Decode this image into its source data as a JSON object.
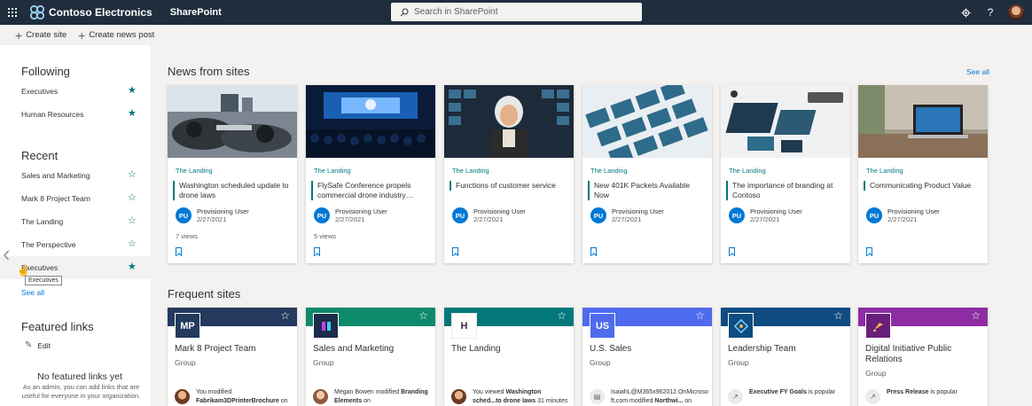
{
  "suite": {
    "brand": "Contoso Electronics",
    "app": "SharePoint",
    "search_placeholder": "Search in SharePoint",
    "settings_icon": "gear-icon",
    "help_label": "?"
  },
  "commands": [
    {
      "label": "Create site"
    },
    {
      "label": "Create news post"
    }
  ],
  "nav": {
    "following_title": "Following",
    "following": [
      {
        "label": "Executives"
      },
      {
        "label": "Human Resources"
      }
    ],
    "recent_title": "Recent",
    "recent": [
      {
        "label": "Sales and Marketing"
      },
      {
        "label": "Mark 8 Project Team"
      },
      {
        "label": "The Landing"
      },
      {
        "label": "The Perspective"
      },
      {
        "label": "Executives"
      }
    ],
    "see_all": "See all",
    "tooltip": "Executives",
    "featured_title": "Featured links",
    "edit": "Edit",
    "no_links_title": "No featured links yet",
    "no_links_desc": "As an admin, you can add links that are useful for everyone in your organization."
  },
  "news": {
    "title": "News from sites",
    "see_all": "See all",
    "items": [
      {
        "site": "The Landing",
        "title": "Washington scheduled update to drone laws",
        "initials": "PU",
        "author": "Provisioning User",
        "date": "2/27/2021",
        "views": "7 views"
      },
      {
        "site": "The Landing",
        "title": "FlySafe Conference propels commercial drone industry…",
        "initials": "PU",
        "author": "Provisioning User",
        "date": "2/27/2021",
        "views": "5 views"
      },
      {
        "site": "The Landing",
        "title": "Functions of customer service",
        "initials": "PU",
        "author": "Provisioning User",
        "date": "2/27/2021",
        "views": ""
      },
      {
        "site": "The Landing",
        "title": "New 401K Packets Available Now",
        "initials": "PU",
        "author": "Provisioning User",
        "date": "2/27/2021",
        "views": ""
      },
      {
        "site": "The Landing",
        "title": "The importance of branding at Contoso",
        "initials": "PU",
        "author": "Provisioning User",
        "date": "2/27/2021",
        "views": ""
      },
      {
        "site": "The Landing",
        "title": "Communicating Product Value",
        "initials": "PU",
        "author": "Provisioning User",
        "date": "2/27/2021",
        "views": ""
      }
    ]
  },
  "frequent": {
    "title": "Frequent sites",
    "items": [
      {
        "logo": "MP",
        "name": "Mark 8 Project Team",
        "type": "Group",
        "band": "#243a5e",
        "logo_bg": "#243a5e",
        "act_pre": "You modified ",
        "act_bold": "Fabrikam3DPrinterBrochure",
        "act_post": " on"
      },
      {
        "logo": "",
        "name": "Sales and Marketing",
        "type": "Group",
        "band": "#0d8a6b",
        "logo_bg": "#1b2c4a",
        "act_pre": "Megan Bowen modified ",
        "act_bold": "Branding Elements",
        "act_post": " on"
      },
      {
        "logo": "H",
        "name": "The Landing",
        "type": "Group",
        "band": "#03787c",
        "logo_bg": "#ffffff",
        "act_pre": "You viewed ",
        "act_bold": "Washington sched...to drone laws",
        "act_post": " 31 minutes"
      },
      {
        "logo": "US",
        "name": "U.S. Sales",
        "type": "Group",
        "band": "#4f6bed",
        "logo_bg": "#4f6bed",
        "act_pre": "IsaiahL@M365x962012.OnMicrosoft.com modified ",
        "act_bold": "Northwi...",
        "act_post": " on"
      },
      {
        "logo": "",
        "name": "Leadership Team",
        "type": "Group",
        "band": "#0f4c81",
        "logo_bg": "#0f4c81",
        "act_pre": "",
        "act_bold": "Executive FY Goals",
        "act_post": " is popular"
      },
      {
        "logo": "",
        "name": "Digital Initiative Public Relations",
        "type": "Group",
        "band": "#8e2ca3",
        "logo_bg": "#6a1f7a",
        "act_pre": "",
        "act_bold": "Press Release",
        "act_post": " is popular"
      }
    ]
  }
}
